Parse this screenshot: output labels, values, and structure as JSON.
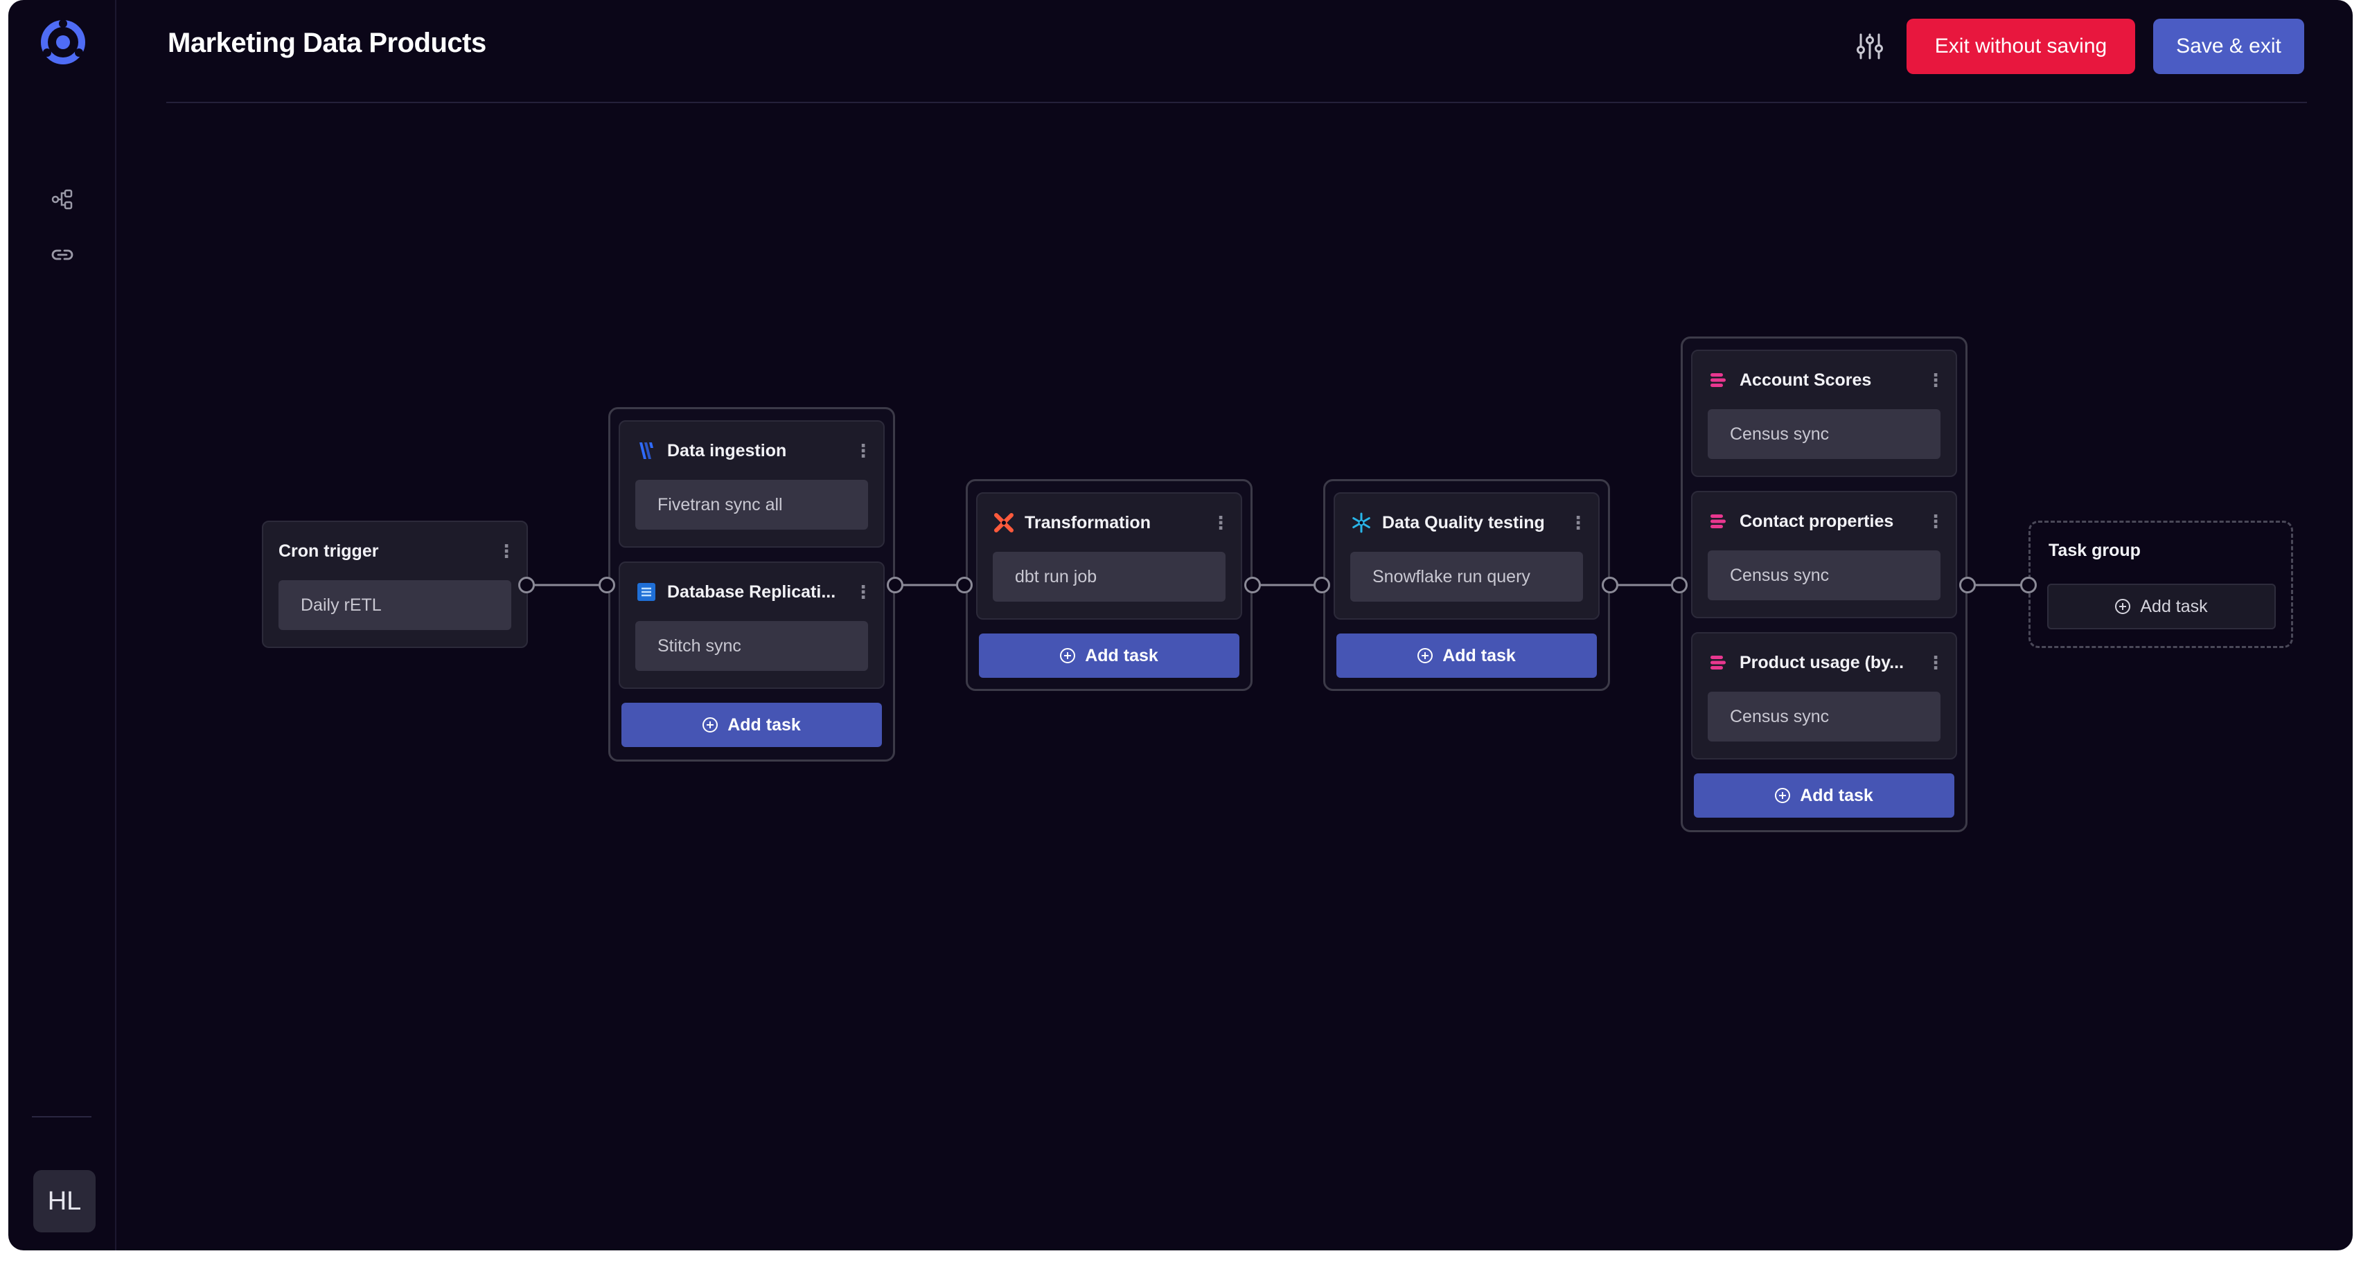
{
  "app": {
    "title": "Marketing Data Products",
    "avatar_initials": "HL",
    "colors": {
      "background": "#0b0618",
      "danger": "#e8173e",
      "primary": "#4b5cc4",
      "add_button": "#4655b4"
    },
    "sidebar_icons": [
      "app-logo-icon",
      "workflow-icon",
      "link-icon"
    ]
  },
  "header": {
    "settings_icon": "sliders-icon",
    "exit_label": "Exit without saving",
    "save_label": "Save & exit"
  },
  "pipeline": {
    "cron": {
      "title": "Cron trigger",
      "body": "Daily rETL"
    },
    "ingestion_group": {
      "tasks": [
        {
          "title": "Data ingestion",
          "body": "Fivetran sync all",
          "icon": "fivetran-icon"
        },
        {
          "title": "Database Replicati...",
          "body": "Stitch sync",
          "icon": "stitch-icon"
        }
      ],
      "add_label": "Add task"
    },
    "transformation_group": {
      "tasks": [
        {
          "title": "Transformation",
          "body": "dbt run job",
          "icon": "dbt-icon"
        }
      ],
      "add_label": "Add task"
    },
    "quality_group": {
      "tasks": [
        {
          "title": "Data Quality testing",
          "body": "Snowflake run query",
          "icon": "snowflake-icon"
        }
      ],
      "add_label": "Add task"
    },
    "census_group": {
      "tasks": [
        {
          "title": "Account Scores",
          "body": "Census sync",
          "icon": "census-icon"
        },
        {
          "title": "Contact properties",
          "body": "Census sync",
          "icon": "census-icon"
        },
        {
          "title": "Product usage (by...",
          "body": "Census sync",
          "icon": "census-icon"
        }
      ],
      "add_label": "Add task"
    },
    "empty_group": {
      "title": "Task group",
      "add_label": "Add task"
    }
  }
}
